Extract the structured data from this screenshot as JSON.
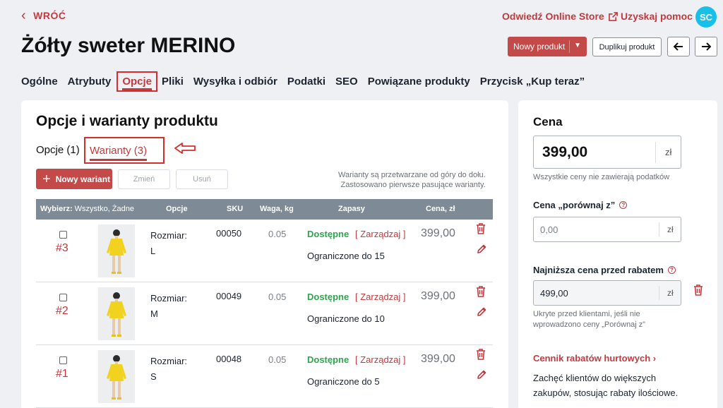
{
  "topbar": {
    "back_label": "WRÓĆ",
    "visit_label": "Odwiedź Online Store",
    "help_label": "Uzyskaj pomoc",
    "avatar_initials": "SC"
  },
  "product": {
    "title": "Żółty sweter MERINO",
    "new_product_label": "Nowy produkt",
    "duplicate_label": "Duplikuj produkt"
  },
  "tabs": [
    "Ogólne",
    "Atrybuty",
    "Opcje",
    "Pliki",
    "Wysyłka i odbiór",
    "Podatki",
    "SEO",
    "Powiązane produkty",
    "Przycisk „Kup teraz”"
  ],
  "active_tab": "Opcje",
  "main": {
    "title": "Opcje i warianty produktu",
    "subtab_options": "Opcje (1)",
    "subtab_variants": "Warianty (3)",
    "new_variant_label": "Nowy wariant",
    "change_label": "Zmień",
    "delete_label": "Usuń",
    "note_line1": "Warianty są przetwarzane od góry do dołu.",
    "note_line2": "Zastosowano pierwsze pasujące warianty."
  },
  "table": {
    "select_label": "Wybierz:",
    "select_options": "Wszystko, Żadne",
    "col_options": "Opcje",
    "col_sku": "SKU",
    "col_weight": "Waga, kg",
    "col_stock": "Zapasy",
    "col_price": "Cena, zł"
  },
  "variants": [
    {
      "num": "#3",
      "option_name": "Rozmiar:",
      "option_value": "L",
      "sku": "00050",
      "weight": "0.05",
      "availability": "Dostępne",
      "manage": "[ Zarządzaj ]",
      "limit": "Ograniczone do 15",
      "price": "399,00"
    },
    {
      "num": "#2",
      "option_name": "Rozmiar:",
      "option_value": "M",
      "sku": "00049",
      "weight": "0.05",
      "availability": "Dostępne",
      "manage": "[ Zarządzaj ]",
      "limit": "Ograniczone do 10",
      "price": "399,00"
    },
    {
      "num": "#1",
      "option_name": "Rozmiar:",
      "option_value": "S",
      "sku": "00048",
      "weight": "0.05",
      "availability": "Dostępne",
      "manage": "[ Zarządzaj ]",
      "limit": "Ograniczone do 5",
      "price": "399,00"
    }
  ],
  "side": {
    "price_title": "Cena",
    "price_value": "399,00",
    "currency": "zł",
    "price_note": "Wszystkie ceny nie zawierają podatków",
    "compare_label": "Cena „porównaj z”",
    "compare_value": "0,00",
    "lowest_label": "Najniższa cena przed rabatem",
    "lowest_value": "499,00",
    "lowest_note_line1": "Ukryte przed klientami, jeśli nie",
    "lowest_note_line2": "wprowadzono ceny „Porównaj z”",
    "wholesale_link": "Cennik rabatów hurtowych",
    "wholesale_text": "Zachęć klientów do większych zakupów, stosując rabaty ilościowe."
  },
  "colors": {
    "accent": "#c4393e",
    "button": "#c44a4a",
    "available": "#2ea44f",
    "table_header": "#7e8b96",
    "annotation": "#d82d2d",
    "avatar": "#18c0e8"
  }
}
